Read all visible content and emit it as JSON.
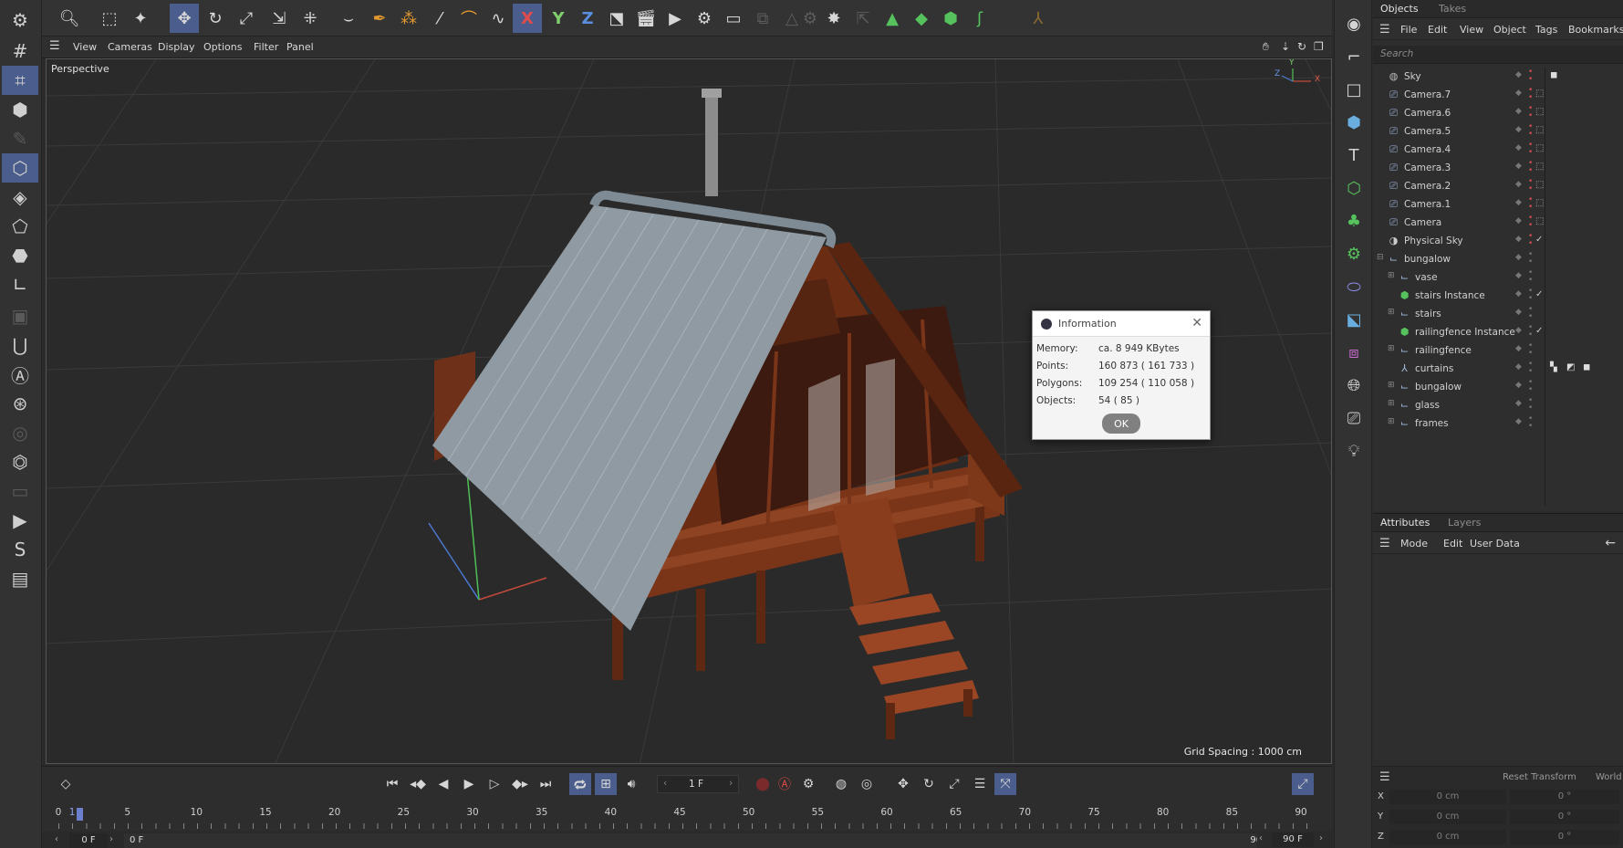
{
  "viewport": {
    "menu": [
      "View",
      "Cameras",
      "Display",
      "Options",
      "Filter",
      "Panel"
    ],
    "label": "Perspective",
    "grid_spacing": "Grid Spacing : 1000 cm",
    "axis_labels": {
      "y": "Y",
      "x": "X",
      "z": "Z"
    }
  },
  "info_dialog": {
    "title": "Information",
    "rows": [
      {
        "label": "Memory:",
        "value": "ca. 8 949 KBytes"
      },
      {
        "label": "Points:",
        "value": "160 873 ( 161 733 )"
      },
      {
        "label": "Polygons:",
        "value": "109 254 ( 110 058 )"
      },
      {
        "label": "Objects:",
        "value": "54 ( 85 )"
      }
    ],
    "ok_label": "OK"
  },
  "toolbar": {
    "axis_x": "X",
    "axis_y": "Y",
    "axis_z": "Z"
  },
  "objects_panel": {
    "tabs": [
      "Objects",
      "Takes"
    ],
    "menu": [
      "File",
      "Edit",
      "View",
      "Object",
      "Tags",
      "Bookmarks"
    ],
    "search_placeholder": "Search",
    "items": [
      {
        "name": "Sky",
        "icon": "sky-icon",
        "indent": 0
      },
      {
        "name": "Camera.7",
        "icon": "camera-icon",
        "indent": 0
      },
      {
        "name": "Camera.6",
        "icon": "camera-icon",
        "indent": 0
      },
      {
        "name": "Camera.5",
        "icon": "camera-icon",
        "indent": 0
      },
      {
        "name": "Camera.4",
        "icon": "camera-icon",
        "indent": 0
      },
      {
        "name": "Camera.3",
        "icon": "camera-icon",
        "indent": 0
      },
      {
        "name": "Camera.2",
        "icon": "camera-icon",
        "indent": 0
      },
      {
        "name": "Camera.1",
        "icon": "camera-icon",
        "indent": 0
      },
      {
        "name": "Camera",
        "icon": "camera-icon",
        "indent": 0
      },
      {
        "name": "Physical Sky",
        "icon": "physical-sky-icon",
        "indent": 0
      },
      {
        "name": "bungalow",
        "icon": "null-icon",
        "indent": 0
      },
      {
        "name": "vase",
        "icon": "null-icon",
        "indent": 1
      },
      {
        "name": "stairs Instance",
        "icon": "instance-icon",
        "indent": 1
      },
      {
        "name": "stairs",
        "icon": "null-icon",
        "indent": 1
      },
      {
        "name": "railingfence Instance",
        "icon": "instance-icon",
        "indent": 1
      },
      {
        "name": "railingfence",
        "icon": "null-icon",
        "indent": 1
      },
      {
        "name": "curtains",
        "icon": "cloth-icon",
        "indent": 1
      },
      {
        "name": "bungalow",
        "icon": "null-icon",
        "indent": 1
      },
      {
        "name": "glass",
        "icon": "null-icon",
        "indent": 1
      },
      {
        "name": "frames",
        "icon": "null-icon",
        "indent": 1
      }
    ]
  },
  "attributes_panel": {
    "tabs": [
      "Attributes",
      "Layers"
    ],
    "menu": [
      "Mode",
      "Edit",
      "User Data"
    ],
    "reset_transform": "Reset Transform",
    "world": "World",
    "coords": [
      {
        "axis": "X",
        "pos": "0 cm",
        "rot": "0 °"
      },
      {
        "axis": "Y",
        "pos": "0 cm",
        "rot": "0 °"
      },
      {
        "axis": "Z",
        "pos": "0 cm",
        "rot": "0 °"
      }
    ]
  },
  "timeline": {
    "current_frame": "1 F",
    "ruler": [
      "0",
      "1",
      "5",
      "10",
      "15",
      "20",
      "25",
      "30",
      "35",
      "40",
      "45",
      "50",
      "55",
      "60",
      "65",
      "70",
      "75",
      "80",
      "85",
      "90"
    ],
    "range_start": "0 F",
    "range_min": "0 F",
    "range_end": "90 F",
    "range_max": "90 F"
  }
}
